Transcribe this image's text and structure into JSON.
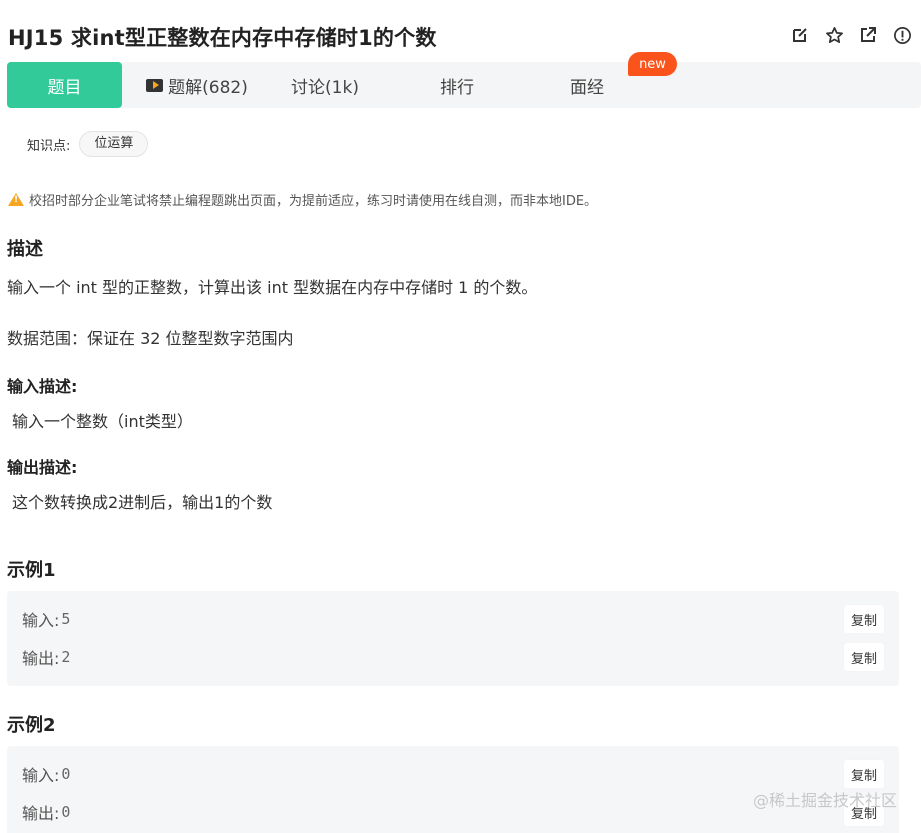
{
  "header": {
    "title": "HJ15  求int型正整数在内存中存储时1的个数",
    "actions": [
      {
        "icon": "edit-icon"
      },
      {
        "icon": "star-icon"
      },
      {
        "icon": "share-icon"
      },
      {
        "icon": "info-icon"
      }
    ]
  },
  "tabs": [
    {
      "label": "题目",
      "active": true
    },
    {
      "label": "题解(682)",
      "icon": "video-play-icon"
    },
    {
      "label": "讨论(1k)"
    },
    {
      "label": "排行"
    },
    {
      "label": "面经",
      "badge": "new"
    }
  ],
  "knowledge": {
    "label": "知识点:",
    "tags": [
      "位运算"
    ]
  },
  "warning": "校招时部分企业笔试将禁止编程题跳出页面，为提前适应，练习时请使用在线自测，而非本地IDE。",
  "description": {
    "heading": "描述",
    "text": "输入一个 int 型的正整数，计算出该 int 型数据在内存中存储时 1 的个数。",
    "range": "数据范围：保证在 32 位整型数字范围内"
  },
  "input_desc": {
    "heading": "输入描述:",
    "text": "输入一个整数（int类型）"
  },
  "output_desc": {
    "heading": "输出描述:",
    "text": "这个数转换成2进制后，输出1的个数"
  },
  "examples": [
    {
      "heading": "示例1",
      "input_label": "输入:",
      "input": "5",
      "output_label": "输出:",
      "output": "2",
      "copy_label": "复制"
    },
    {
      "heading": "示例2",
      "input_label": "输入:",
      "input": "0",
      "output_label": "输出:",
      "output": "0",
      "copy_label": "复制"
    }
  ],
  "watermark": "@稀土掘金技术社区",
  "colors": {
    "accent": "#32ca99",
    "badge": "#fa541c",
    "warning": "#f5a623"
  }
}
